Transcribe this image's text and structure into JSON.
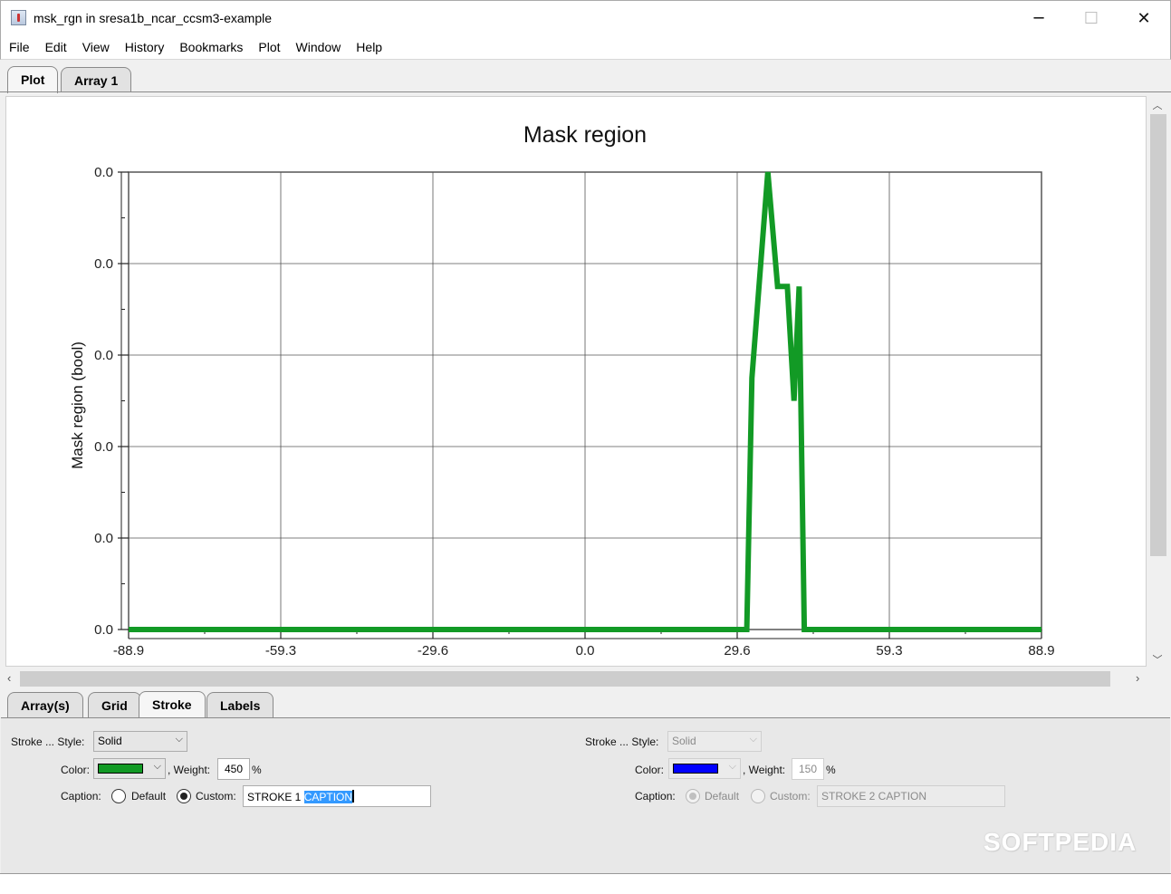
{
  "window": {
    "title": "msk_rgn in sresa1b_ncar_ccsm3-example"
  },
  "menu": [
    "File",
    "Edit",
    "View",
    "History",
    "Bookmarks",
    "Plot",
    "Window",
    "Help"
  ],
  "top_tabs": {
    "plot": "Plot",
    "array1": "Array 1"
  },
  "bottom_tabs": {
    "arrays": "Array(s)",
    "grid": "Grid",
    "stroke": "Stroke",
    "labels": "Labels"
  },
  "stroke1": {
    "style_label": "Stroke ... Style:",
    "style_value": "Solid",
    "color_label": "Color:",
    "color": "#129a25",
    "weight_label": ", Weight:",
    "weight": "450",
    "percent": "%",
    "caption_label": "Caption:",
    "default_label": "Default",
    "custom_label": "Custom:",
    "caption_prefix": "STROKE 1 ",
    "caption_selected": "CAPTION"
  },
  "stroke2": {
    "style_label": "Stroke ... Style:",
    "style_value": "Solid",
    "color_label": "Color:",
    "color": "#0000ff",
    "weight_label": ", Weight:",
    "weight": "150",
    "percent": "%",
    "caption_label": "Caption:",
    "default_label": "Default",
    "custom_label": "Custom:",
    "caption_text": "STROKE 2 CAPTION"
  },
  "watermark": "SOFTPEDIA",
  "chart_data": {
    "type": "line",
    "title": "Mask region",
    "ylabel": "Mask region (bool)",
    "xlabel": "",
    "xlim": [
      -88.9,
      88.9
    ],
    "ylim": [
      0,
      1
    ],
    "x_ticks": [
      "-88.9",
      "-59.3",
      "-29.6",
      "0.0",
      "29.6",
      "59.3",
      "88.9"
    ],
    "y_ticks": [
      "0.0",
      "0.0",
      "0.0",
      "0.0",
      "0.0",
      "0.0"
    ],
    "grid": true,
    "series_color": "#129a25",
    "series": [
      {
        "x": [
          -88.9,
          31.5,
          32.5,
          35.6,
          37.5,
          39.4,
          40.7,
          41.7,
          42.7,
          43.8,
          88.9
        ],
        "y": [
          0.0,
          0.0,
          0.55,
          1.0,
          0.75,
          0.75,
          0.5,
          0.75,
          0.0,
          0.0,
          0.0
        ]
      }
    ]
  }
}
